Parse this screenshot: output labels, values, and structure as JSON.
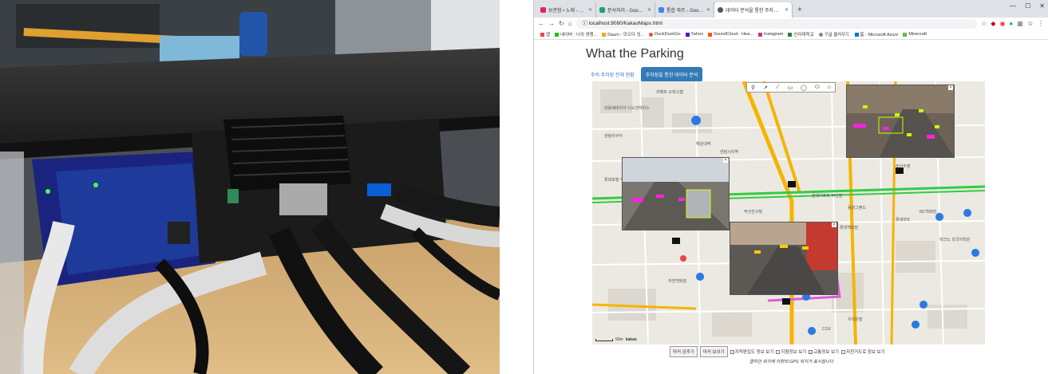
{
  "browser": {
    "tabs": [
      {
        "label": "보관함 • 노래 - VIBE",
        "color": "#e0245e"
      },
      {
        "label": "문서처리 - Google 드라이브",
        "color": "#1fa463"
      },
      {
        "label": "통합 파트 - Google 문서",
        "color": "#4285f4"
      },
      {
        "label": "데이터 분석을 통한 주차현황",
        "color": "#555555"
      }
    ],
    "url": "localhost:8080/KakaoMaps.html",
    "bookmarks": [
      "앱",
      "네이버 : 나의 경쟁...",
      "Daum - 모으다 잇...",
      "DuckDuckGo",
      "Yahoo",
      "SoundCloud - Hea...",
      "Instagram",
      "신라대학교",
      "구글 클라우드",
      "홈 - Microsoft Azure",
      "Minecraft"
    ]
  },
  "page": {
    "title": "What the Parking",
    "tabs": [
      "주의 주차장 전체 현황",
      "주차장을 통한 데이터 분석"
    ]
  },
  "map": {
    "toolbar": [
      "⚲",
      "↗",
      "⟋",
      "▭",
      "◯",
      "⬭",
      "⌂"
    ],
    "scale_label": "50m",
    "logo": "kakao",
    "labels": [
      "라페르 오피스텔",
      "대동베네치아 디오션테라스",
      "센텀아쿠아",
      "해운대역",
      "센텀시티역",
      "현대기프트 부산점",
      "롯데호텔 부산점",
      "부산진구청",
      "동양그랜드",
      "롯데마트",
      "NC백화점",
      "자연백화점",
      "테크노 외국어학원",
      "부산수영",
      "CGV",
      "롯데백화점",
      "우리은행"
    ]
  },
  "controls": {
    "hide_markers": "마커 감추기",
    "show_markers": "마커 보이기",
    "options": [
      {
        "label": "지적편집도 정보 보기",
        "checked": false
      },
      {
        "label": "지형정보 보기",
        "checked": false
      },
      {
        "label": "교통정보 보기",
        "checked": true
      },
      {
        "label": "자전거도로 정보 보기",
        "checked": false
      }
    ],
    "note": "클릭한 위치에 차량의 GPS 위치가 표시됩니다"
  }
}
